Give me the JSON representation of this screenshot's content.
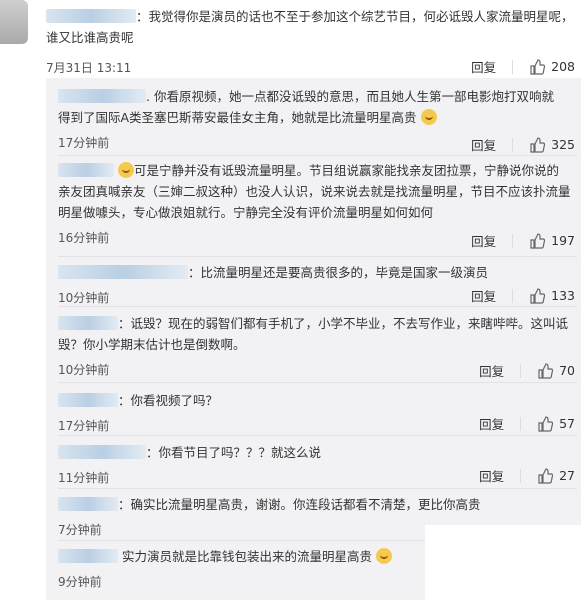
{
  "main_comment": {
    "line1": "：我觉得你是演员的话也不至于参加这个综艺节目，何必诋毁人家流量明星呢，",
    "line2": "谁又比谁高贵呢",
    "time": "7月31日 13:11",
    "reply_label": "回复",
    "likes": "208"
  },
  "replies": [
    {
      "line1": ". 你看原视频，她一点都没诋毁的意思，而且她人生第一部电影炮打双响就",
      "line2": "得到了国际A类圣塞巴斯蒂安最佳女主角，她就是比流量明星高贵",
      "time": "17分钟前",
      "reply_label": "回复",
      "likes": "325"
    },
    {
      "line1": "可是宁静并没有诋毁流量明星。节目组说赢家能找亲友团拉票，宁静说你说的",
      "line2": "亲友团真喊亲友（三婶二叔这种）也没人认识，说来说去就是找流量明星，节目不应该扑流量",
      "line3": "明星做噱头，专心做浪姐就行。宁静完全没有评价流量明星如何如何",
      "time": "16分钟前",
      "reply_label": "回复",
      "likes": "197"
    },
    {
      "line1": "：比流量明星还是要高贵很多的，毕竟是国家一级演员",
      "time": "10分钟前",
      "reply_label": "回复",
      "likes": "133"
    },
    {
      "line1": "：诋毁？现在的弱智们都有手机了，小学不毕业，不去写作业，来瞎哔哔。这叫诋",
      "line2": "毁？你小学期末估计也是倒数啊。",
      "time": "10分钟前",
      "reply_label": "回复",
      "likes": "70"
    },
    {
      "line1": "：你看视频了吗？",
      "time": "17分钟前",
      "reply_label": "回复",
      "likes": "57"
    },
    {
      "line1": "：你看节目了吗？？？就这么说",
      "time": "11分钟前",
      "reply_label": "回复",
      "likes": "27"
    },
    {
      "line1": "：确实比流量明星高贵，谢谢。你连段话都看不清楚，更比你高贵",
      "time": "7分钟前",
      "reply_label": "回复",
      "likes": ""
    },
    {
      "line1": "实力演员就是比靠钱包装出来的流量明星高贵",
      "time": "9分钟前",
      "reply_label": "",
      "likes": ""
    }
  ]
}
